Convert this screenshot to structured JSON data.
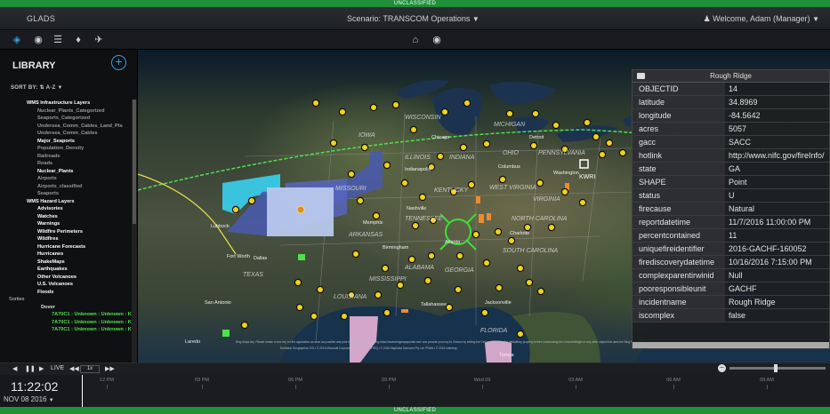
{
  "classification": {
    "top": "UNCLASSIFIED",
    "bottom": "UNCLASSIFIED"
  },
  "header": {
    "app_name": "GLADS",
    "scenario": "Scenario: TRANSCOM Operations",
    "user": "Welcome, Adam (Manager)"
  },
  "toolbar": {
    "icons": [
      "layers-icon",
      "camera-icon",
      "list-icon",
      "tag-icon",
      "airplane-icon"
    ],
    "center_icons": [
      "home-icon",
      "camera-icon"
    ]
  },
  "library": {
    "title": "LIBRARY",
    "sort_label": "SORT BY:",
    "sort_value": "A-Z",
    "items": [
      {
        "label": "WMS Infrastructure Layers",
        "level": "h1"
      },
      {
        "label": "Nuclear_Plants_Categorized",
        "level": "h2"
      },
      {
        "label": "Seaports_Categorized",
        "level": "h2"
      },
      {
        "label": "Undersea_Comm_Cables_Land_Pts",
        "level": "h2"
      },
      {
        "label": "Undersea_Comm_Cables",
        "level": "h2"
      },
      {
        "label": "Major_Seaports",
        "level": "h2on"
      },
      {
        "label": "Population_Density",
        "level": "h2"
      },
      {
        "label": "Railroads",
        "level": "h2"
      },
      {
        "label": "Roads",
        "level": "h2"
      },
      {
        "label": "Nuclear_Plants",
        "level": "h2on"
      },
      {
        "label": "Airports",
        "level": "h2"
      },
      {
        "label": "Airports_classified",
        "level": "h2"
      },
      {
        "label": "Seaports",
        "level": "h2"
      },
      {
        "label": "WMS Hazard Layers",
        "level": "h1"
      },
      {
        "label": "Advisories",
        "level": "h2on"
      },
      {
        "label": "Watches",
        "level": "h2on"
      },
      {
        "label": "Warnings",
        "level": "h2on"
      },
      {
        "label": "Wildfire Perimeters",
        "level": "h2on"
      },
      {
        "label": "Wildfires",
        "level": "h2on"
      },
      {
        "label": "Hurricane Forecasts",
        "level": "h2on"
      },
      {
        "label": "Hurricanes",
        "level": "h2on"
      },
      {
        "label": "ShakeMaps",
        "level": "h2on"
      },
      {
        "label": "Earthquakes",
        "level": "h2on"
      },
      {
        "label": "Other Volcanoes",
        "level": "h2on"
      },
      {
        "label": "U.S. Volcanoes",
        "level": "h2on"
      },
      {
        "label": "Floods",
        "level": "h2on"
      },
      {
        "label": "Sorties",
        "level": "s0"
      },
      {
        "label": "Dover",
        "level": "s1"
      },
      {
        "label": "7A70C1 : Unknown : Unknown : K",
        "level": "s2"
      },
      {
        "label": "7A70C1 : Unknown : Unknown : K",
        "level": "s2"
      },
      {
        "label": "7A70C1 : Unknown : Unknown : K",
        "level": "s2"
      }
    ]
  },
  "map": {
    "state_labels": [
      "WISCONSIN",
      "MICHIGAN",
      "IOWA",
      "ILLINOIS",
      "INDIANA",
      "OHIO",
      "PENNSYLVANIA",
      "MISSOURI",
      "KENTUCKY",
      "WEST VIRGINIA",
      "VIRGINIA",
      "ARKANSAS",
      "TENNESSEE",
      "NORTH CAROLINA",
      "SOUTH CAROLINA",
      "MISSISSIPPI",
      "ALABAMA",
      "GEORGIA",
      "LOUISIANA",
      "TEXAS",
      "FLORIDA"
    ],
    "city_labels": [
      "Chicago",
      "Detroit",
      "Indianapolis",
      "Columbus",
      "Washington",
      "Nashville",
      "Memphis",
      "Charlotte",
      "Atlanta",
      "Birmingham",
      "Dallas",
      "Fort Worth",
      "Tallahassee",
      "Jacksonville",
      "San Antonio",
      "Laredo",
      "Tampa",
      "Lubbock"
    ],
    "marker_label": "KWRI",
    "attribution": "Bing Maps key. Please create a new key for the application as soon as possible and prior to deployment by visiting https://www.bingmapsportal.com/ and provide your key to Cesium by setting the Cesium.BingMapsApi.defaultKey property before constructing the CesiumWidget or any other object that uses the Bing Maps API.",
    "attribution2": "Earthstar Geographics SIO • © 2016 Microsoft Corporation • © 2016 NAVTEQ • © 2016 MapData Sciences Pty Ltd, PSMA • © 2016 Intermap"
  },
  "popup": {
    "title": "Rough Ridge",
    "rows": [
      {
        "k": "OBJECTID",
        "v": "14"
      },
      {
        "k": "latitude",
        "v": "34.8969"
      },
      {
        "k": "longitude",
        "v": "-84.5642"
      },
      {
        "k": "acres",
        "v": "5057"
      },
      {
        "k": "gacc",
        "v": "SACC"
      },
      {
        "k": "hotlink",
        "v": "http://www.nifc.gov/fireInfo/"
      },
      {
        "k": "state",
        "v": "GA"
      },
      {
        "k": "SHAPE",
        "v": "Point"
      },
      {
        "k": "status",
        "v": "U"
      },
      {
        "k": "firecause",
        "v": "Natural"
      },
      {
        "k": "reportdatetime",
        "v": "11/7/2016 11:00:00 PM"
      },
      {
        "k": "percentcontained",
        "v": "11"
      },
      {
        "k": "uniquefireidentifier",
        "v": "2016-GACHF-160052"
      },
      {
        "k": "firediscoverydatetime",
        "v": "10/16/2016 7:15:00 PM"
      },
      {
        "k": "complexparentirwinid",
        "v": "Null"
      },
      {
        "k": "pooresponsibleunit",
        "v": "GACHF"
      },
      {
        "k": "incidentname",
        "v": "Rough Ridge"
      },
      {
        "k": "iscomplex",
        "v": "false"
      }
    ]
  },
  "timeline": {
    "live_label": "LIVE",
    "speed": "1x",
    "clock_time": "11:22:02",
    "clock_date": "NOV 08 2016",
    "ticks": [
      "12 PM",
      "03 PM",
      "06 PM",
      "09 PM",
      "Wed 09",
      "03 AM",
      "06 AM",
      "09 AM"
    ]
  }
}
